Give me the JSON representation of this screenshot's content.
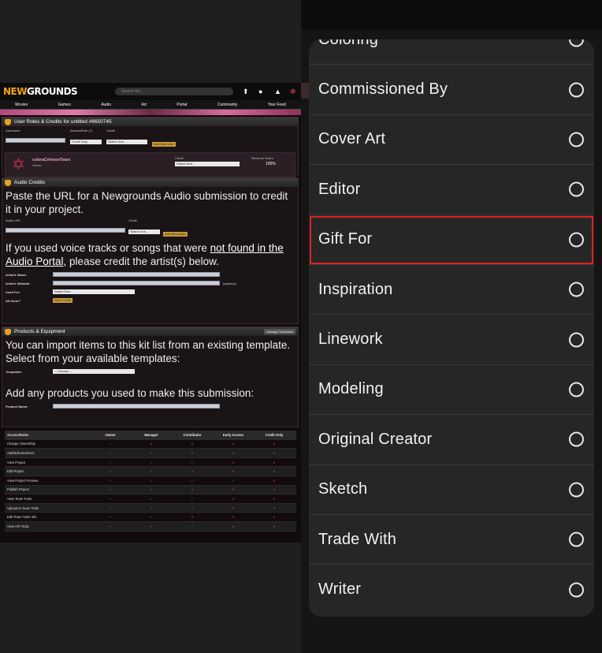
{
  "newgrounds": {
    "logo_a": "NEW",
    "logo_b": "GROUNDS",
    "search_placeholder": "Search Art...",
    "nav": [
      "Movies",
      "Games",
      "Audio",
      "Art",
      "Portal",
      "Community",
      "Your Feed"
    ],
    "roles_section": {
      "title": "User Roles & Credits for untitled #6650745",
      "username_label": "Username",
      "access_label": "Access/Role (?)",
      "access_value": "Credit Only",
      "credit_label": "Credit",
      "credit_value": "Select One...",
      "add_user": "Add New User",
      "owner_name": "coloraCrimsonTears",
      "owner_role": "Owner",
      "owner_credit_label": "Credit",
      "owner_credit_value": "Select One...",
      "revenue_label": "Revenue Share",
      "revenue_value": "100%"
    },
    "audio_section": {
      "title": "Audio Credits",
      "intro": "Paste the URL for a Newgrounds Audio submission to credit it in your project.",
      "url_label": "Audio URL",
      "credit_label": "Credit",
      "credit_value": "Select One...",
      "add_audio": "Add New Audio",
      "voice_text_a": "If you used voice tracks or songs that were ",
      "voice_link": "not found in the Audio Portal",
      "voice_text_b": ", please credit the artist(s) below.",
      "artist_name": "Artist's Name:",
      "artist_site": "Artist's Website:",
      "optional": "(optional)",
      "used_for": "Used For:",
      "used_value": "Select One...",
      "all_done": "All Done?",
      "save_credit": "Save Credit"
    },
    "products_section": {
      "title": "Products & Equipment",
      "manage": "Manage Templates",
      "import_text": "You can import items to this kit list from an existing template. Select from your available templates:",
      "templates_label": "Templates:",
      "templates_value": "---Choose---",
      "add_text": "Add any products you used to make this submission:",
      "product_name": "Product Name:"
    },
    "table": {
      "headers": [
        "Access/Roles",
        "Owner",
        "Manager",
        "Contributor",
        "Early Access",
        "Credit Only"
      ],
      "rows": [
        {
          "name": "Change Ownership",
          "v": [
            "ok",
            "no",
            "no",
            "no",
            "no"
          ]
        },
        {
          "name": "Add/Edit Members",
          "v": [
            "ok",
            "ok",
            "no",
            "no",
            "no"
          ]
        },
        {
          "name": "View Project",
          "v": [
            "ok",
            "ok",
            "ok",
            "no",
            "no"
          ]
        },
        {
          "name": "Edit Project",
          "v": [
            "ok",
            "ok",
            "no",
            "no",
            "no"
          ]
        },
        {
          "name": "View Project Preview",
          "v": [
            "ok",
            "ok",
            "ok",
            "ok",
            "no"
          ]
        },
        {
          "name": "Publish Project",
          "v": [
            "ok",
            "ok",
            "no",
            "no",
            "no"
          ]
        },
        {
          "name": "View Team Tools",
          "v": [
            "ok",
            "ok",
            "ok",
            "no",
            "no"
          ]
        },
        {
          "name": "Upload to Team Tools",
          "v": [
            "ok",
            "ok",
            "ok",
            "no",
            "no"
          ]
        },
        {
          "name": "Edit Team Tools Info",
          "v": [
            "ok",
            "ok",
            "no",
            "no",
            "no"
          ]
        },
        {
          "name": "View API Tools",
          "v": [
            "ok",
            "ok",
            "ok",
            "no",
            "no"
          ]
        }
      ]
    }
  },
  "options": [
    {
      "label": "Coloring",
      "selected": false
    },
    {
      "label": "Commissioned By",
      "selected": false
    },
    {
      "label": "Cover Art",
      "selected": false
    },
    {
      "label": "Editor",
      "selected": false
    },
    {
      "label": "Gift For",
      "selected": false,
      "highlighted": true
    },
    {
      "label": "Inspiration",
      "selected": false
    },
    {
      "label": "Linework",
      "selected": false
    },
    {
      "label": "Modeling",
      "selected": false
    },
    {
      "label": "Original Creator",
      "selected": false
    },
    {
      "label": "Sketch",
      "selected": false
    },
    {
      "label": "Trade With",
      "selected": false
    },
    {
      "label": "Writer",
      "selected": false
    }
  ],
  "colors": {
    "highlight": "#e02020",
    "card": "#262626",
    "ng_orange": "#f7a21b"
  }
}
